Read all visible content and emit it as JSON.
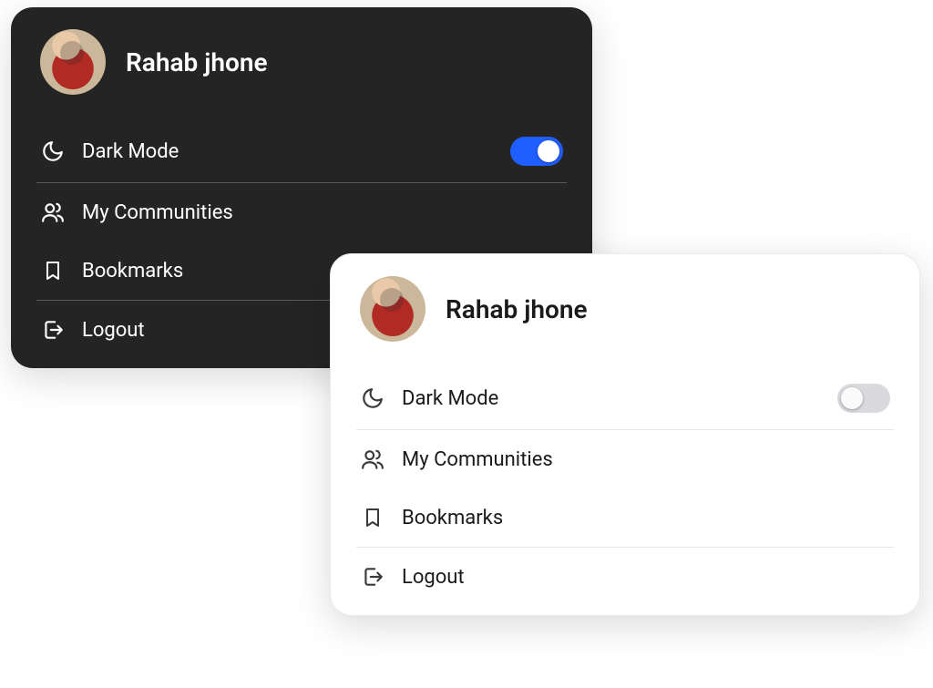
{
  "user": {
    "name": "Rahab jhone"
  },
  "menu": {
    "darkMode": "Dark Mode",
    "communities": "My Communities",
    "bookmarks": "Bookmarks",
    "logout": "Logout"
  },
  "dark": {
    "toggleOn": true
  },
  "light": {
    "toggleOn": false
  },
  "colors": {
    "accent": "#1f5eff"
  }
}
